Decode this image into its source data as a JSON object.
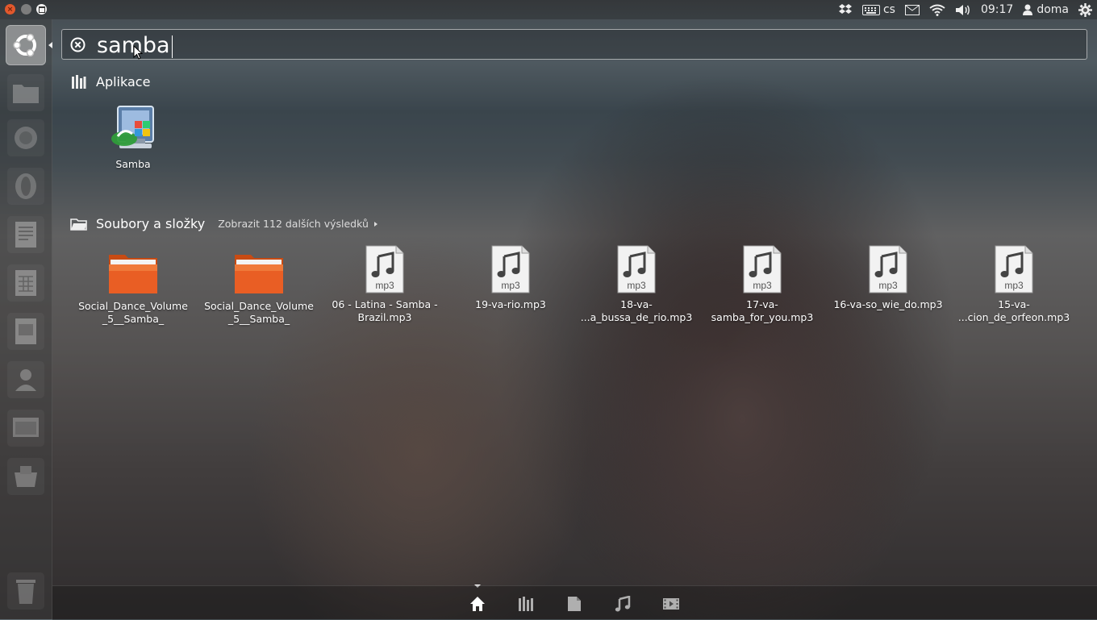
{
  "panel": {
    "keyboard_layout": "cs",
    "clock": "09:17",
    "user": "doma"
  },
  "search": {
    "query": "samba"
  },
  "applications": {
    "title": "Aplikace",
    "items": [
      {
        "label": "Samba"
      }
    ]
  },
  "files": {
    "title": "Soubory a složky",
    "more": "Zobrazit 112 dalších výsledků",
    "items": [
      {
        "type": "folder",
        "line1": "Social_Dance_Volume",
        "line2": "_5__Samba_"
      },
      {
        "type": "folder",
        "line1": "Social_Dance_Volume",
        "line2": "_5__Samba_"
      },
      {
        "type": "mp3",
        "line1": "06 - Latina - Samba -",
        "line2": "Brazil.mp3"
      },
      {
        "type": "mp3",
        "line1": "19-va-rio.mp3",
        "line2": ""
      },
      {
        "type": "mp3",
        "line1": "18-va-",
        "line2": "...a_bussa_de_rio.mp3"
      },
      {
        "type": "mp3",
        "line1": "17-va-",
        "line2": "samba_for_you.mp3"
      },
      {
        "type": "mp3",
        "line1": "16-va-so_wie_do.mp3",
        "line2": ""
      },
      {
        "type": "mp3",
        "line1": "15-va-",
        "line2": "...cion_de_orfeon.mp3"
      }
    ],
    "file_type_badge": "mp3"
  },
  "lenses": [
    "home",
    "applications",
    "files",
    "music",
    "video"
  ],
  "colors": {
    "accent_orange": "#e95e24",
    "close_button": "#e2582c"
  }
}
